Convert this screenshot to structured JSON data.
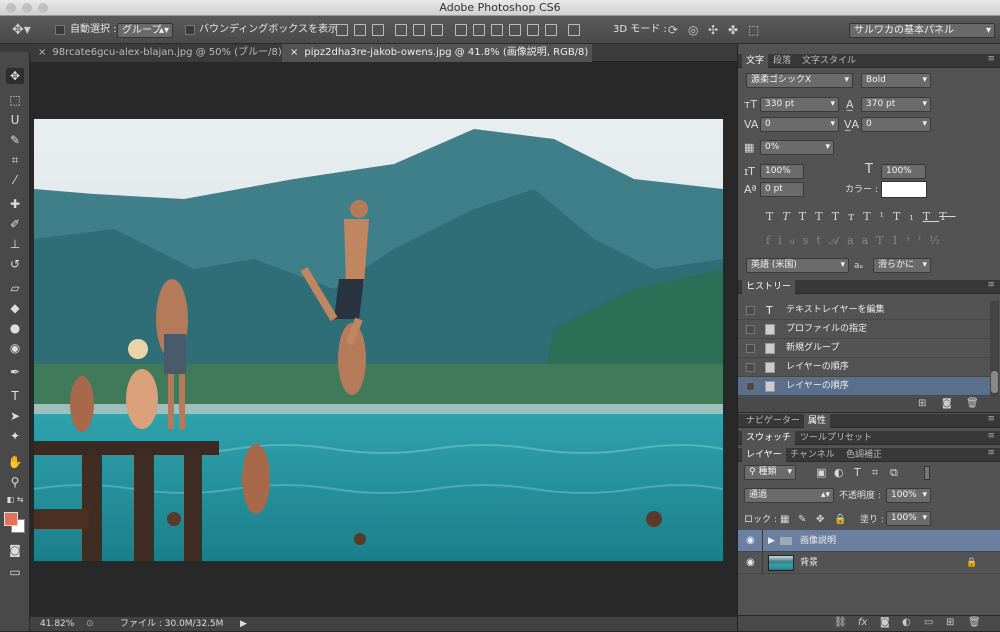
{
  "app": {
    "title": "Adobe Photoshop CS6"
  },
  "options": {
    "auto_select_label": "自動選択 :",
    "auto_select_value": "グループ",
    "bounding_box_label": "バウンディングボックスを表示",
    "mode_3d_label": "3D モード :",
    "workspace": "サルワカの基本パネル"
  },
  "tabs": [
    {
      "label": "98rcate6gcu-alex-blajan.jpg @ 50% (ブルー/8) *"
    },
    {
      "label": "pipz2dha3re-jakob-owens.jpg @ 41.8% (画像説明, RGB/8) *"
    }
  ],
  "status": {
    "zoom": "41.82%",
    "file_info": "ファイル : 30.0M/32.5M"
  },
  "char_panel": {
    "tabs": [
      "文字",
      "段落",
      "文字スタイル"
    ],
    "font_family": "源柔ゴシックX",
    "font_style": "Bold",
    "font_size": "330 pt",
    "leading": "370 pt",
    "kerning": "0",
    "tracking": "0",
    "tsume": "0%",
    "vscale": "100%",
    "hscale": "100%",
    "baseline": "0 pt",
    "color_label": "カラー :",
    "language": "英語 (米国)",
    "antialias_label": "aₐ",
    "antialias": "滑らかに",
    "text_color": "#ffffff"
  },
  "history": {
    "tab": "ヒストリー",
    "items": [
      {
        "label": "テキストレイヤーを編集",
        "icon": "T"
      },
      {
        "label": "プロファイルの指定",
        "icon": "doc"
      },
      {
        "label": "新規グループ",
        "icon": "doc"
      },
      {
        "label": "レイヤーの順序",
        "icon": "doc"
      },
      {
        "label": "レイヤーの順序",
        "icon": "doc",
        "selected": true
      }
    ]
  },
  "nav_tabs": [
    "ナビゲーター",
    "属性"
  ],
  "swatch_tabs": [
    "スウォッチ",
    "ツールプリセット"
  ],
  "layers_tabs": [
    "レイヤー",
    "チャンネル",
    "色調補正"
  ],
  "layers": {
    "kind_filter": "種類",
    "blend_mode": "通過",
    "opacity_label": "不透明度 :",
    "opacity": "100%",
    "lock_label": "ロック :",
    "fill_label": "塗り :",
    "fill": "100%",
    "items": [
      {
        "name": "画像説明",
        "type": "group",
        "selected": true
      },
      {
        "name": "背景",
        "type": "background",
        "locked": true
      }
    ]
  },
  "colors": {
    "foreground": "#e8705a",
    "background": "#ffffff",
    "selection": "#5a6f8c"
  }
}
